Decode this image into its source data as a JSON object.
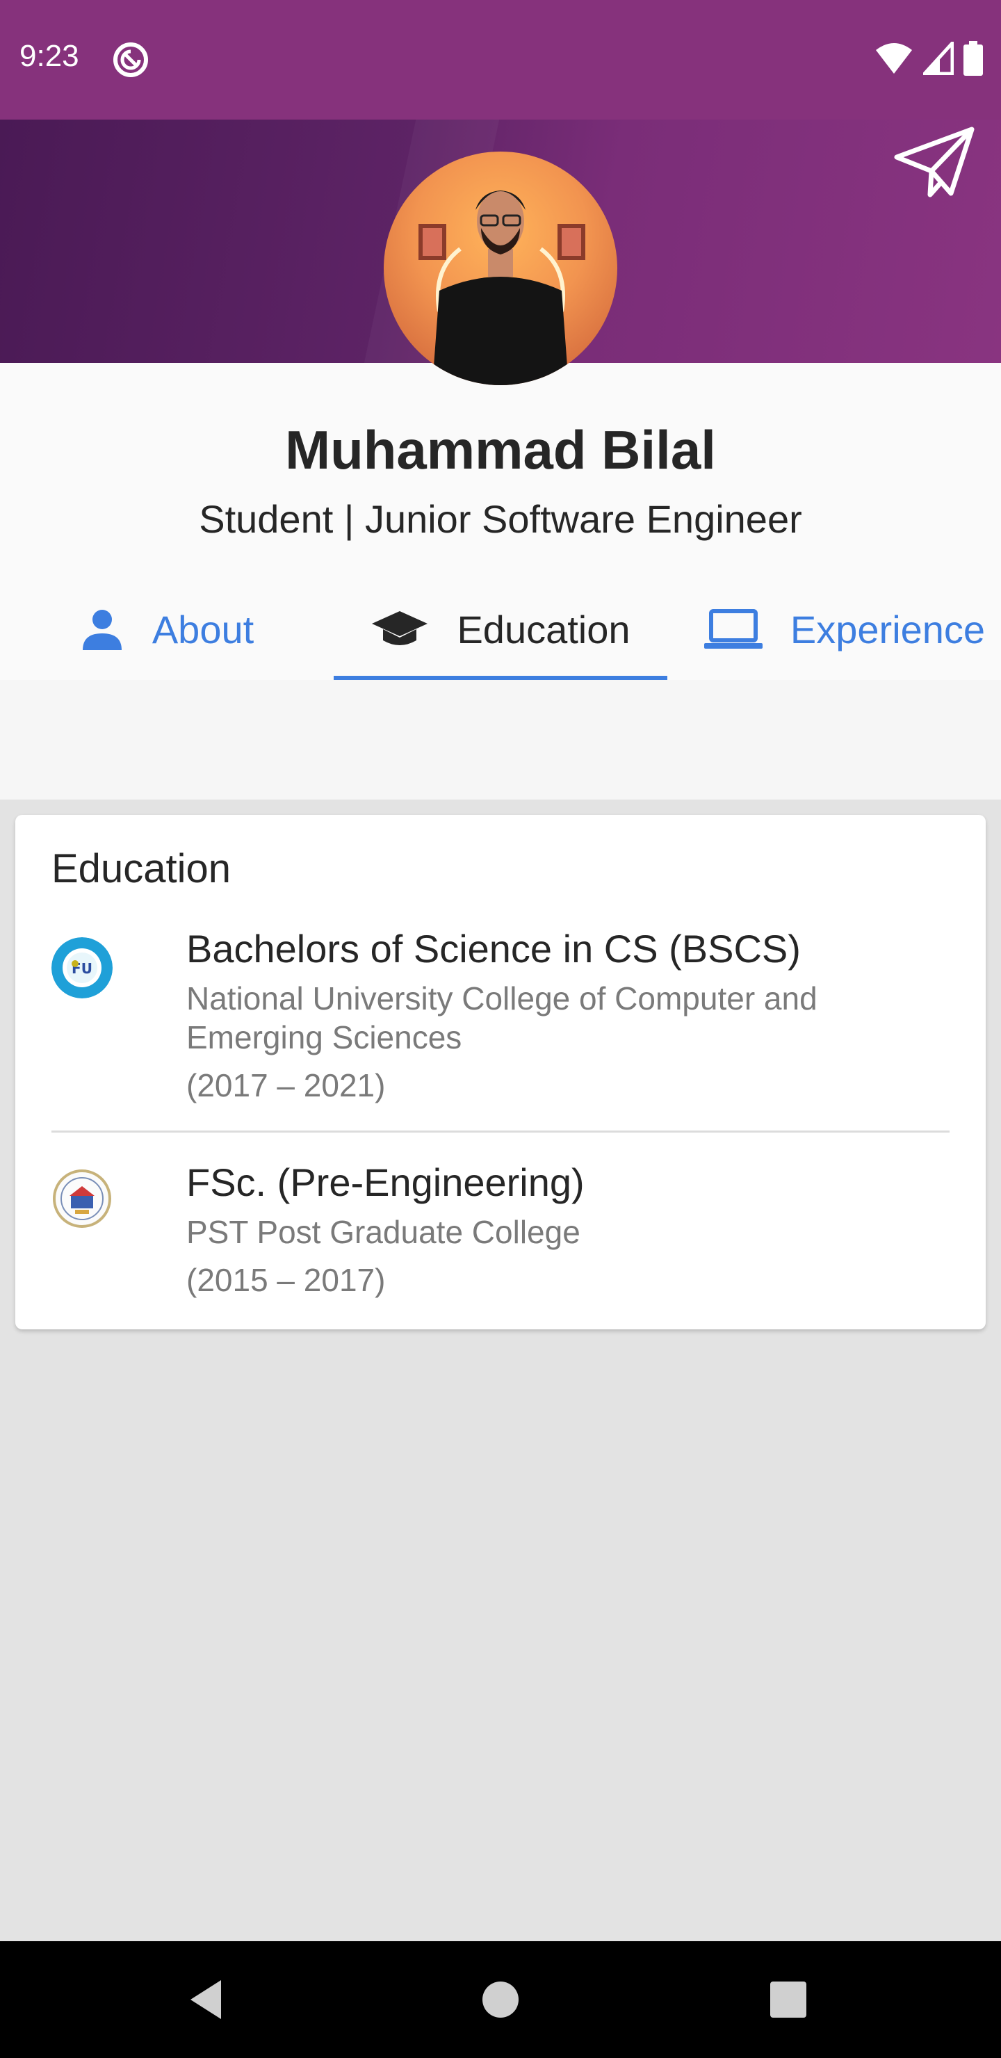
{
  "status_bar": {
    "time": "9:23"
  },
  "profile": {
    "name": "Muhammad Bilal",
    "subtitle": "Student | Junior Software Engineer"
  },
  "tabs": [
    {
      "label": "About",
      "icon": "person-icon",
      "active": false
    },
    {
      "label": "Education",
      "icon": "graduation-cap-icon",
      "active": true
    },
    {
      "label": "Experience",
      "icon": "laptop-icon",
      "active": false
    }
  ],
  "education": {
    "title": "Education",
    "items": [
      {
        "degree": "Bachelors of Science in CS (BSCS)",
        "school": "National University College of Computer and Emerging Sciences",
        "years": "(2017 – 2021)",
        "logo": "fast-nu-logo"
      },
      {
        "degree": "FSc. (Pre-Engineering)",
        "school": "PST Post Graduate College",
        "years": "(2015 – 2017)",
        "logo": "pst-college-logo"
      }
    ]
  },
  "colors": {
    "status_bar": "#86327c",
    "accent": "#3d7ee0",
    "header_start": "#4a1a55",
    "header_end": "#893480"
  }
}
